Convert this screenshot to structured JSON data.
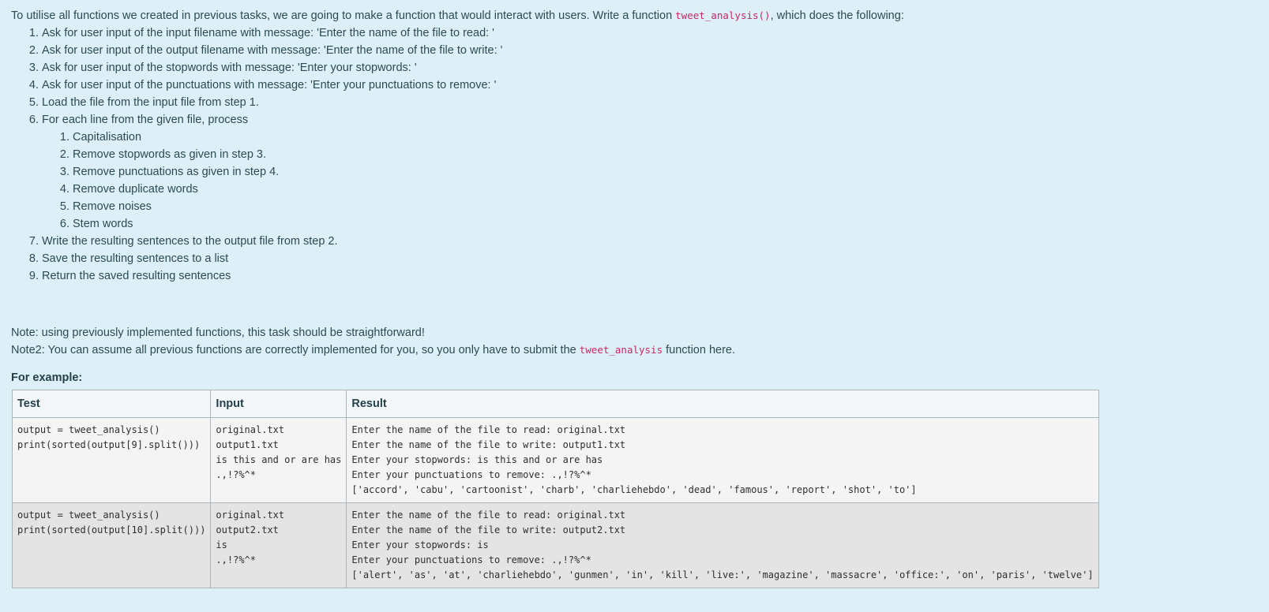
{
  "intro": {
    "before_code": "To utilise all functions we created in previous tasks, we are going to make a function that would interact with users. Write a function ",
    "code": "tweet_analysis()",
    "after_code": ", which does the following:"
  },
  "steps": [
    "Ask for user input of the input filename with message: 'Enter the name of the file to read: '",
    "Ask for user input of the output filename with message: 'Enter the name of the file to write: '",
    "Ask for user input of the stopwords with message: 'Enter your stopwords: '",
    "Ask for user input of the punctuations with message: 'Enter your punctuations to remove: '",
    "Load the file from the input file from step 1.",
    "For each line from the given file, process",
    "Write the resulting sentences to the output file from step 2.",
    "Save the resulting sentences to a list",
    "Return the saved resulting sentences"
  ],
  "substeps": [
    "Capitalisation",
    "Remove stopwords as given in step 3.",
    "Remove punctuations as given in step 4.",
    "Remove duplicate words",
    "Remove noises",
    "Stem words"
  ],
  "notes": {
    "note1": "Note: using previously implemented functions, this task should be straightforward!",
    "note2_before": "Note2: You can assume all previous functions are correctly implemented for you, so you only have to submit the ",
    "note2_code": "tweet_analysis",
    "note2_after": " function here."
  },
  "example_heading": "For example:",
  "table": {
    "headers": [
      "Test",
      "Input",
      "Result"
    ],
    "rows": [
      {
        "test": "output = tweet_analysis()\nprint(sorted(output[9].split()))",
        "input": "original.txt\noutput1.txt\nis this and or are has\n.,!?%^*",
        "result": "Enter the name of the file to read: original.txt\nEnter the name of the file to write: output1.txt\nEnter your stopwords: is this and or are has\nEnter your punctuations to remove: .,!?%^*\n['accord', 'cabu', 'cartoonist', 'charb', 'charliehebdo', 'dead', 'famous', 'report', 'shot', 'to']"
      },
      {
        "test": "output = tweet_analysis()\nprint(sorted(output[10].split()))",
        "input": "original.txt\noutput2.txt\nis\n.,!?%^*",
        "result": "Enter the name of the file to read: original.txt\nEnter the name of the file to write: output2.txt\nEnter your stopwords: is\nEnter your punctuations to remove: .,!?%^*\n['alert', 'as', 'at', 'charliehebdo', 'gunmen', 'in', 'kill', 'live:', 'magazine', 'massacre', 'office:', 'on', 'paris', 'twelve']"
      }
    ]
  },
  "colors": {
    "background": "#def0f7",
    "text": "#2b4a55",
    "code": "#c7256a",
    "table_border": "#a9b7bd"
  }
}
